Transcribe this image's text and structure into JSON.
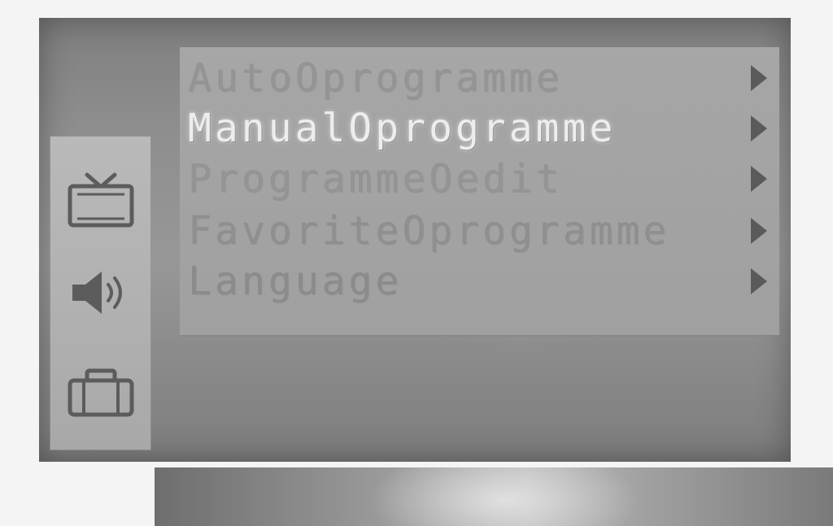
{
  "osd": {
    "side_tabs": [
      {
        "icon": "tv-icon",
        "selected": true
      },
      {
        "icon": "speaker-icon",
        "selected": false
      },
      {
        "icon": "toolbox-icon",
        "selected": false
      }
    ],
    "menu": {
      "items": [
        {
          "label": "AutoOprogramme",
          "active": false
        },
        {
          "label": "ManualOprogramme",
          "active": true
        },
        {
          "label": "ProgrammeOedit",
          "active": false
        },
        {
          "label": "FavoriteOprogramme",
          "active": false
        },
        {
          "label": "Language",
          "active": false
        }
      ],
      "submenu_arrow": "▶"
    },
    "colors": {
      "panel_bg": "#a6a6a6",
      "highlight_text": "#ededed",
      "normal_text": "#8e8e8e",
      "arrow": "#5a5a5a"
    }
  }
}
